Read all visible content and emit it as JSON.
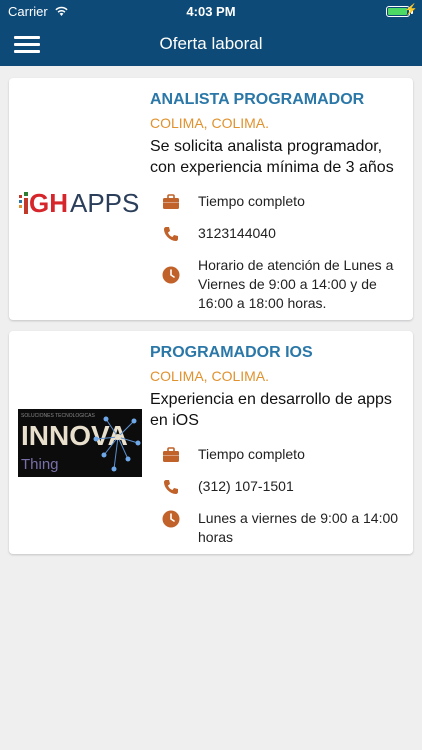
{
  "status_bar": {
    "carrier": "Carrier",
    "time": "4:03 PM",
    "battery_level": 0.9,
    "battery_color": "#4cd964"
  },
  "nav": {
    "title": "Oferta laboral",
    "menu_icon": "hamburger-menu-icon"
  },
  "colors": {
    "nav_bg": "#0d4a77",
    "title": "#2a77a8",
    "location": "#e0922f",
    "icon": "#c0622a"
  },
  "jobs": [
    {
      "title": "ANALISTA PROGRAMADOR",
      "location": "COLIMA, COLIMA.",
      "description": "Se solicita analista programador, con experiencia mínima de 3 años",
      "logo": {
        "text": "GHAPPS"
      },
      "schedule_type": "Tiempo completo",
      "phone": "3123144040",
      "hours": "Horario de atención de Lunes a Viernes de 9:00 a 14:00 y de 16:00 a 18:00 horas."
    },
    {
      "title": "PROGRAMADOR IOS",
      "location": "COLIMA, COLIMA.",
      "description": "Experiencia en desarrollo de apps en iOS",
      "logo": {
        "text": "INNOVA",
        "tagline": "SOLUCIONES TECNOLOGICAS",
        "subtext": "Thing"
      },
      "schedule_type": "Tiempo completo",
      "phone": "(312) 107-1501",
      "hours": "Lunes a viernes de 9:00 a 14:00 horas"
    }
  ]
}
